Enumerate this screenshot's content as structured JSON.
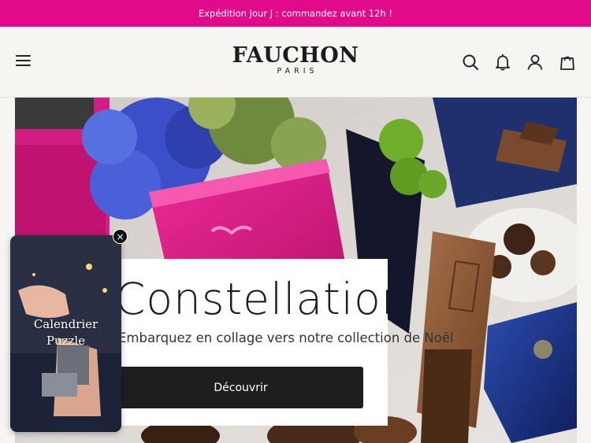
{
  "announcement": {
    "text": "Expédition Jour J : commandez avant 12h !"
  },
  "header": {
    "brand": "FAUCHON",
    "city": "PARIS",
    "icons": [
      "menu-icon",
      "search-icon",
      "bell-icon",
      "user-icon",
      "cart-icon"
    ]
  },
  "hero": {
    "title": "Constellations",
    "subtitle": "Embarquez en collage vers notre collection de Noël",
    "cta": "Découvrir"
  },
  "story_widget": {
    "label_line1": "Calendrier",
    "label_line2": "Puzzle",
    "close_label": "×"
  },
  "colors": {
    "announcement_bg": "#e10a8a",
    "header_bg": "#f7f5f1",
    "cta_bg": "#1e1e1e"
  }
}
